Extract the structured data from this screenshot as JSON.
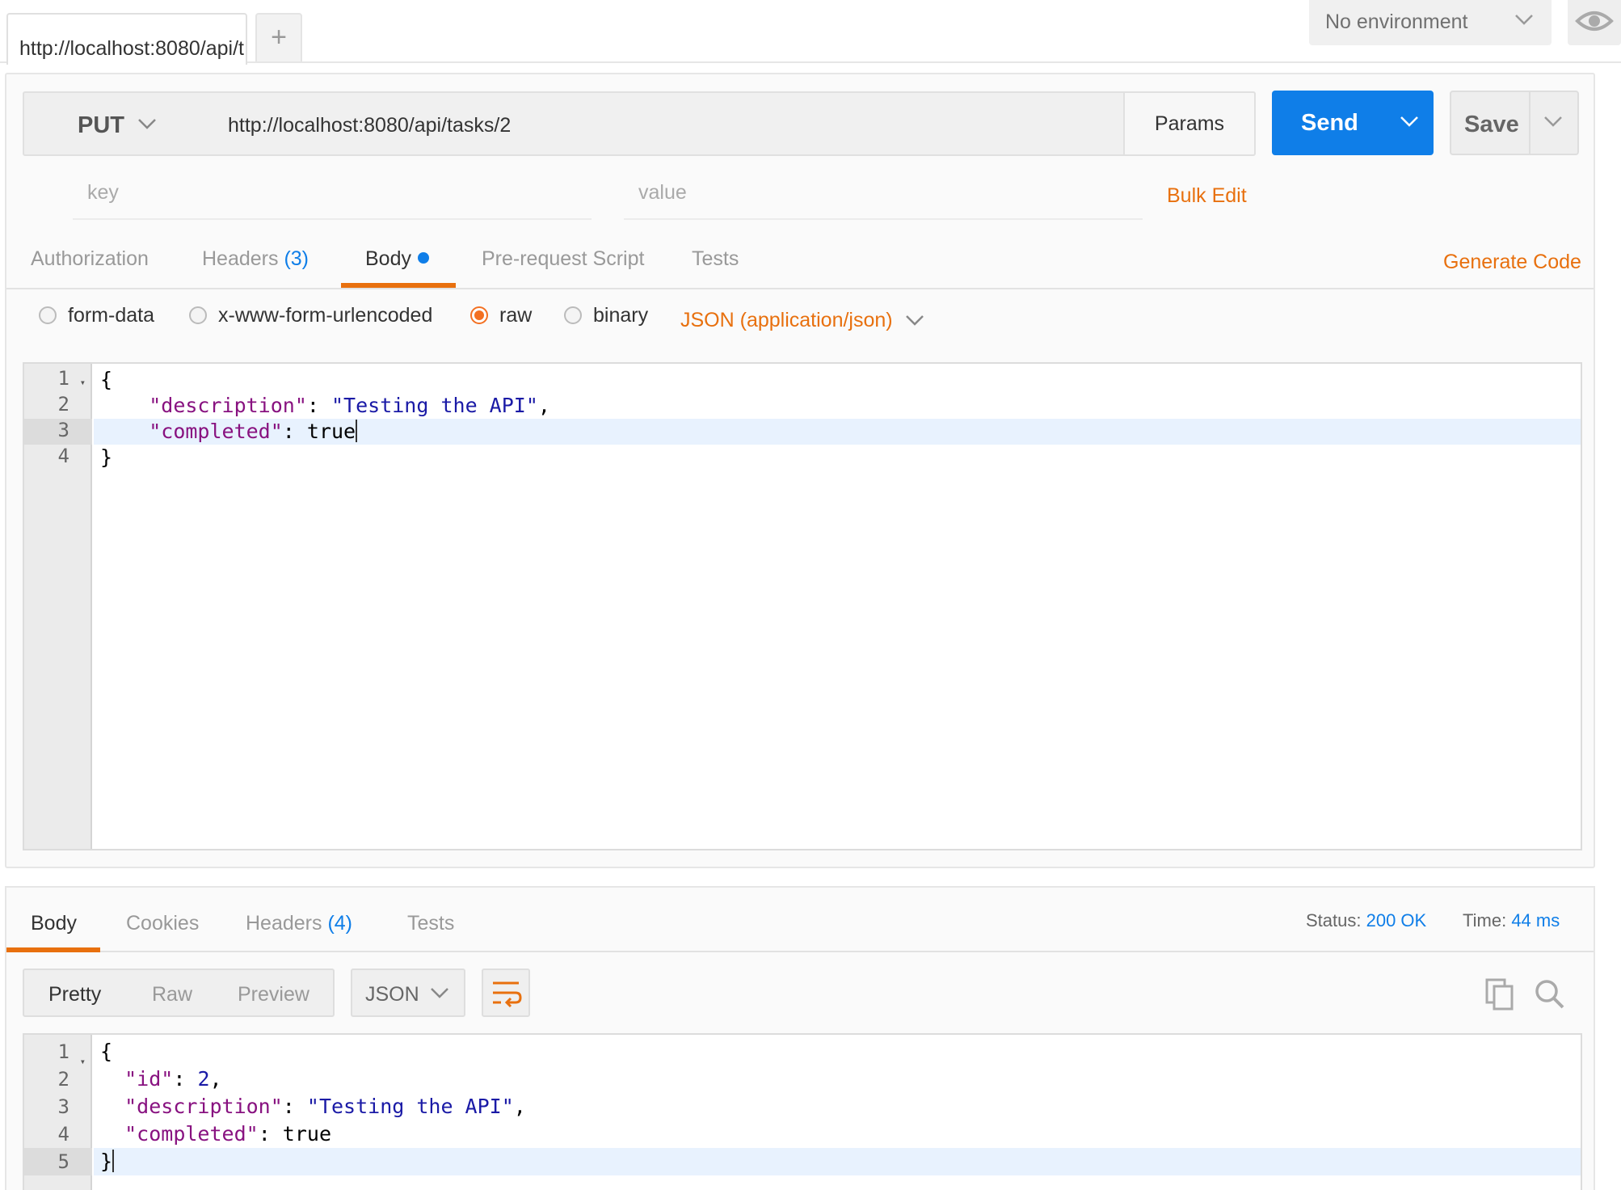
{
  "tabs": {
    "active_tab_label": "http://localhost:8080/api/t",
    "new_tab_symbol": "+"
  },
  "environment": {
    "selected": "No environment"
  },
  "request": {
    "method": "PUT",
    "url": "http://localhost:8080/api/tasks/2",
    "params_label": "Params",
    "send_label": "Send",
    "save_label": "Save",
    "key_placeholder": "key",
    "value_placeholder": "value",
    "bulk_edit_label": "Bulk Edit",
    "tabs": [
      {
        "label": "Authorization",
        "count": ""
      },
      {
        "label": "Headers",
        "count": "(3)"
      },
      {
        "label": "Body",
        "count": ""
      },
      {
        "label": "Pre-request Script",
        "count": ""
      },
      {
        "label": "Tests",
        "count": ""
      }
    ],
    "active_tab": "Body",
    "generate_code_label": "Generate Code",
    "body_modes": [
      "form-data",
      "x-www-form-urlencoded",
      "raw",
      "binary"
    ],
    "selected_body_mode": "raw",
    "content_type": "JSON (application/json)",
    "editor_line_numbers": [
      "1",
      "2",
      "3",
      "4"
    ],
    "editor_lines": [
      "{",
      "    \"description\": \"Testing the API\",",
      "    \"completed\": true",
      "}"
    ]
  },
  "response": {
    "tabs": [
      {
        "label": "Body",
        "count": ""
      },
      {
        "label": "Cookies",
        "count": ""
      },
      {
        "label": "Headers",
        "count": "(4)"
      },
      {
        "label": "Tests",
        "count": ""
      }
    ],
    "active_tab": "Body",
    "status_label": "Status:",
    "status_value": "200 OK",
    "time_label": "Time:",
    "time_value": "44 ms",
    "view_modes": [
      "Pretty",
      "Raw",
      "Preview"
    ],
    "active_view": "Pretty",
    "format": "JSON",
    "editor_line_numbers": [
      "1",
      "2",
      "3",
      "4",
      "5"
    ],
    "editor_lines": [
      "{",
      "  \"id\": 2,",
      "  \"description\": \"Testing the API\",",
      "  \"completed\": true",
      "}"
    ]
  },
  "colors": {
    "accent_orange": "#e8700e",
    "send_blue": "#0f7ee8",
    "json_key": "#881280",
    "json_string": "#1a1aa6"
  },
  "icons": [
    "chevron-down-icon",
    "eye-icon",
    "copy-icon",
    "search-icon",
    "wrap-lines-icon"
  ]
}
